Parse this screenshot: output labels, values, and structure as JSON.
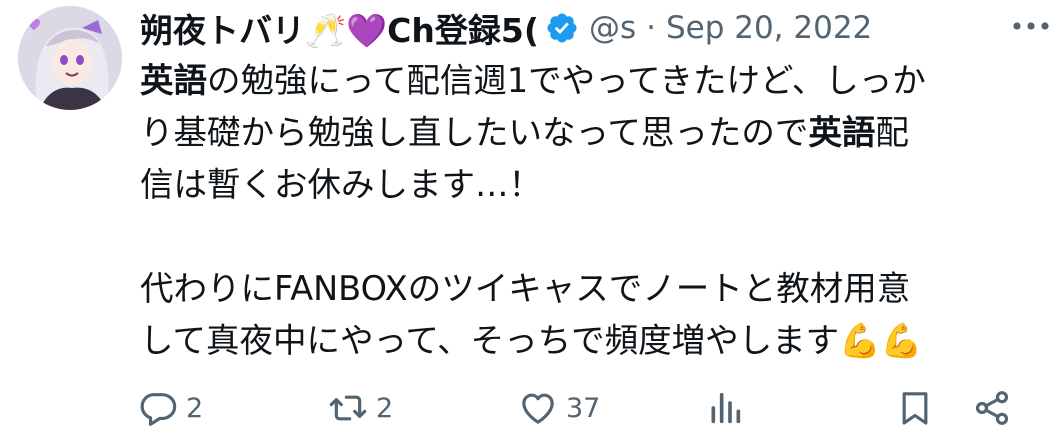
{
  "tweet": {
    "author": {
      "display_name": "朔夜トバリ🥂💜Ch登録5(",
      "handle": "@s",
      "verified": true
    },
    "separator": "·",
    "date": "Sep 20, 2022",
    "body": {
      "p1": {
        "b1": "英語",
        "t1": "の勉強にって配信週1でやってきたけど、しっか",
        "t2": "り基礎から勉強し直したいなって思ったので",
        "b2": "英語",
        "t3": "配",
        "t4": "信は暫くお休みします…！"
      },
      "p2": {
        "line1": "代わりにFANBOXのツイキャスでノートと教材用意",
        "line2": "して真夜中にやって、そっちで頻度増やします💪💪"
      }
    },
    "actions": {
      "replies": "2",
      "reposts": "2",
      "likes": "37"
    }
  },
  "colors": {
    "text": "#0f1419",
    "muted": "#536471",
    "verified": "#1d9bf0"
  },
  "icons": [
    "avatar",
    "verified-badge-icon",
    "more-icon",
    "reply-icon",
    "repost-icon",
    "like-icon",
    "views-icon",
    "bookmark-icon",
    "share-icon"
  ]
}
